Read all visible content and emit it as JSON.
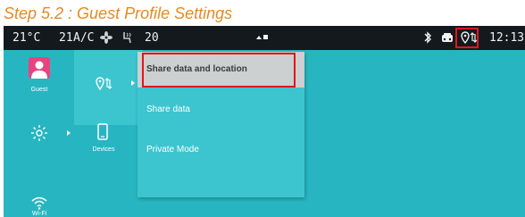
{
  "step_title": "Step 5.2 : Guest Profile Settings",
  "status_bar": {
    "temp_left": "21°C",
    "fan_speed": "21",
    "ac_label": "A/C",
    "temp_right": "20",
    "clock": "12:13"
  },
  "sidebar": {
    "guest_label": "Guest",
    "devices_label": "Devices",
    "wifi_label": "Wi-Fi"
  },
  "dropdown": {
    "items": [
      {
        "label": "Share data and location",
        "selected": true
      },
      {
        "label": "Share data",
        "selected": false
      },
      {
        "label": "Private Mode",
        "selected": false
      }
    ]
  },
  "colors": {
    "accent": "#27b6c1",
    "highlight": "#e2151b",
    "title": "#e8891c"
  }
}
